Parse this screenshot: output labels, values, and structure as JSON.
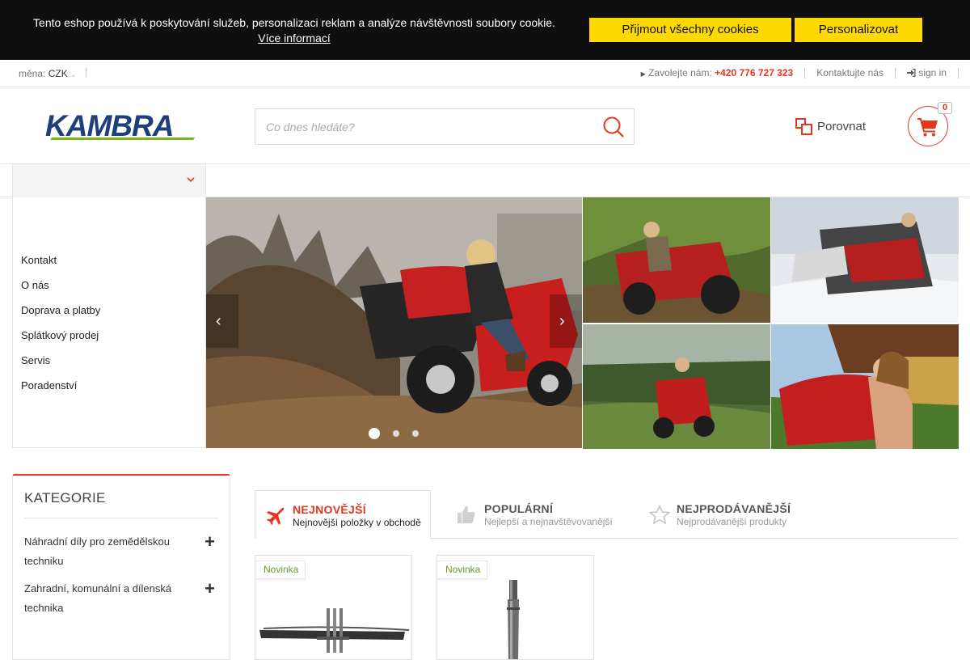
{
  "cookie": {
    "message": "Tento eshop používá k poskytování služeb, personalizaci reklam a analýze návštěvnosti soubory cookie.",
    "more_link": "Více informací",
    "accept_label": "Přijmout všechny cookies",
    "customize_label": "Personalizovat"
  },
  "topbar": {
    "currency_label": "měna:",
    "currency_value": "CZK",
    "call_label": "Zavolejte nám:",
    "phone": "+420 776 727 323",
    "contact_label": "Kontaktujte nás",
    "signin_label": "sign in"
  },
  "header": {
    "logo_text": "KAMBRA",
    "search_placeholder": "Co dnes hledáte?",
    "compare_label": "Porovnat",
    "cart_count": "0"
  },
  "sidemenu": {
    "items": [
      "Kontakt",
      "O nás",
      "Doprava a platby",
      "Splátkový prodej",
      "Servis",
      "Poradenství"
    ]
  },
  "slider": {
    "slide_count": 3,
    "active_slide": 1
  },
  "categories": {
    "title": "KATEGORIE",
    "items": [
      "Náhradní díly pro zemědělskou techniku",
      "Zahradní, komunální a dílenská technika"
    ]
  },
  "tabs": [
    {
      "title": "NEJNOVĚJŠÍ",
      "subtitle": "Nejnovější položky v obchodě",
      "icon": "plane-icon"
    },
    {
      "title": "POPULÁRNÍ",
      "subtitle": "Nejlepší a nejnavštěvovanější",
      "icon": "thumbs-up-icon"
    },
    {
      "title": "NEJPRODÁVANĚJŠÍ",
      "subtitle": "Nejprodávanější produkty",
      "icon": "star-icon"
    }
  ],
  "products": [
    {
      "badge": "Novinka"
    },
    {
      "badge": "Novinka"
    }
  ],
  "colors": {
    "accent": "#e8351d",
    "cookie_button": "#ffd900",
    "logo_blue": "#1f3f7a",
    "logo_green": "#7ab51d",
    "badge_green": "#6c9a27"
  }
}
